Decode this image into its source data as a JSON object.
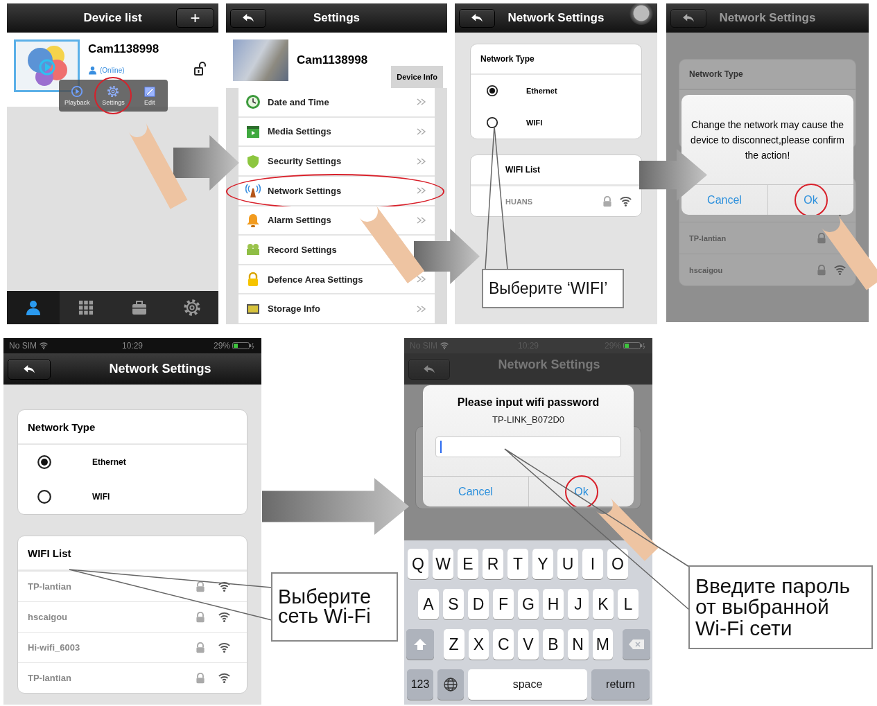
{
  "device_list_screen": {
    "title": "Device list",
    "add_button": "+",
    "device": {
      "name": "Cam1138998",
      "status": "(Online)"
    },
    "popup_menu": [
      {
        "label": "Playback",
        "kind": "playback",
        "selected": false
      },
      {
        "label": "Settings",
        "kind": "settings",
        "selected": true
      },
      {
        "label": "Edit",
        "kind": "edit",
        "selected": false
      }
    ],
    "tab_bar": [
      {
        "kind": "devices",
        "selected": true
      },
      {
        "kind": "grid",
        "selected": false
      },
      {
        "kind": "toolbox",
        "selected": false
      },
      {
        "kind": "settings",
        "selected": false
      }
    ]
  },
  "settings_screen": {
    "title": "Settings",
    "device_name": "Cam1138998",
    "device_info_button": "Device Info",
    "items": [
      {
        "label": "Date and Time",
        "kind": "clock",
        "selected": false
      },
      {
        "label": "Media Settings",
        "kind": "media",
        "selected": false
      },
      {
        "label": "Security Settings",
        "kind": "shield",
        "selected": false
      },
      {
        "label": "Network Settings",
        "kind": "antenna",
        "selected": true
      },
      {
        "label": "Alarm Settings",
        "kind": "bell",
        "selected": false
      },
      {
        "label": "Record Settings",
        "kind": "record",
        "selected": false
      },
      {
        "label": "Defence Area Settings",
        "kind": "lock",
        "selected": false
      },
      {
        "label": "Storage Info",
        "kind": "storage",
        "selected": false
      }
    ]
  },
  "network_type_screen": {
    "title": "Network Settings",
    "network_type": {
      "title": "Network Type",
      "options": [
        {
          "label": "Ethernet",
          "selected": true
        },
        {
          "label": "WIFI",
          "selected": false
        }
      ]
    },
    "wifi_list": {
      "title": "WIFI List",
      "networks": [
        {
          "name": "HUANS"
        }
      ]
    }
  },
  "confirm_screen": {
    "title": "Network Settings",
    "background": {
      "section_title": "Network Type",
      "networks": [
        {
          "name": "TP-lantian"
        },
        {
          "name": "hscaigou"
        }
      ]
    },
    "dialog": {
      "message": "Change the network may cause the device to disconnect,please confirm the action!",
      "buttons": [
        {
          "label": "Cancel",
          "selected": false
        },
        {
          "label": "Ok",
          "selected": true
        }
      ]
    }
  },
  "wifi_list_screen": {
    "status_bar": {
      "carrier": "No SIM",
      "time": "10:29",
      "battery": "29%"
    },
    "title": "Network Settings",
    "network_type": {
      "title": "Network Type",
      "options": [
        {
          "label": "Ethernet",
          "selected": true
        },
        {
          "label": "WIFI",
          "selected": false
        }
      ]
    },
    "wifi_list": {
      "title": "WIFI List",
      "networks": [
        {
          "name": "TP-lantian"
        },
        {
          "name": "hscaigou"
        },
        {
          "name": "Hi-wifi_6003"
        },
        {
          "name": "TP-lantian"
        }
      ]
    }
  },
  "password_screen": {
    "status_bar": {
      "carrier": "No SIM",
      "time": "10:29",
      "battery": "29%"
    },
    "title": "Network Settings",
    "dialog": {
      "title": "Please input wifi password",
      "network": "TP-LINK_B072D0",
      "buttons": [
        {
          "label": "Cancel",
          "selected": false
        },
        {
          "label": "Ok",
          "selected": true
        }
      ]
    },
    "keyboard": {
      "letter_rows": [
        [
          "Q",
          "W",
          "E",
          "R",
          "T",
          "Y",
          "U",
          "I",
          "O"
        ],
        [
          "A",
          "S",
          "D",
          "F",
          "G",
          "H",
          "J",
          "K",
          "L"
        ],
        [
          "Z",
          "X",
          "C",
          "V",
          "B",
          "N",
          "M"
        ]
      ],
      "numbers_key": "123",
      "space_key": "space",
      "return_key": "return"
    }
  },
  "callouts": [
    {
      "text": "Выберите ‘WIFI’"
    },
    {
      "text": "Выберите\nсеть Wi-Fi"
    },
    {
      "text": "Введите пароль\nот выбранной\nWi-Fi сети"
    }
  ]
}
